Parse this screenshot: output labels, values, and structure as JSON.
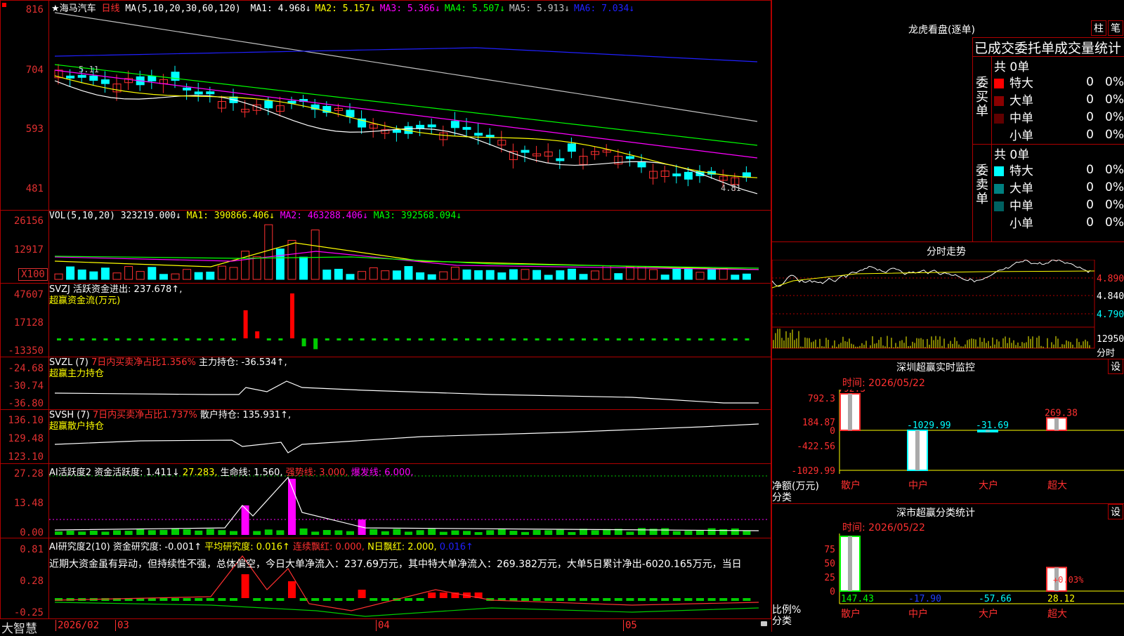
{
  "header": {
    "stock": "★海马汽车",
    "period": "日线",
    "ma_label": "MA(5,10,20,30,60,120)",
    "ma": [
      {
        "label": "MA1:",
        "value": "4.968↓",
        "color": "#ffffff"
      },
      {
        "label": "MA2:",
        "value": "5.157↓",
        "color": "#ffff00"
      },
      {
        "label": "MA3:",
        "value": "5.366↓",
        "color": "#ff00ff"
      },
      {
        "label": "MA4:",
        "value": "5.507↓",
        "color": "#00ff00"
      },
      {
        "label": "MA5:",
        "value": "5.913↓",
        "color": "#c0c0c0"
      },
      {
        "label": "MA6:",
        "value": "7.034↓",
        "color": "#2020ff"
      }
    ],
    "price_high_note": "5.11",
    "price_low_note": "4.81"
  },
  "axes": {
    "price": [
      "816",
      "704",
      "593",
      "481"
    ],
    "vol": [
      "26156",
      "12917",
      "X100"
    ],
    "svzj": [
      "47607",
      "17128",
      "-13350"
    ],
    "svzl": [
      "-24.68",
      "-30.74",
      "-36.80"
    ],
    "svsh": [
      "136.10",
      "129.48",
      "123.10"
    ],
    "ai": [
      "27.28",
      "13.48",
      "0.00"
    ],
    "air": [
      "0.81",
      "0.28",
      "-0.25"
    ]
  },
  "vol_header": {
    "name": "VOL(5,10,20)",
    "value": "323219.000↓",
    "ma1": "MA1: 390866.406↓",
    "ma2": "MA2: 463288.406↓",
    "ma3": "MA3: 392568.094↓"
  },
  "svzj_header": {
    "name": "SVZJ",
    "desc": "活跃资金进出: 237.678↑,",
    "sub": "超赢资金流(万元)"
  },
  "svzl_header": {
    "name": "SVZL (7)",
    "desc": "7日内买卖净占比1.356%",
    "hold": "主力持仓: -36.534↑,",
    "sub": "超赢主力持仓"
  },
  "svsh_header": {
    "name": "SVSH (7)",
    "desc": "7日内买卖净占比1.737%",
    "hold": "散户持仓: 135.931↑,",
    "sub": "超赢散户持仓"
  },
  "ai_header": {
    "name": "AI活跃度2",
    "a": "资金活跃度: 1.411↓",
    "b": "27.283,",
    "c": "生命线: 1.560,",
    "d": "强势线: 3.000,",
    "e": "爆发线: 6.000,"
  },
  "air_header": {
    "name": "AI研究度2(10)",
    "a": "资金研究度: -0.001↑",
    "b": "平均研究度: 0.016↑",
    "c": "连续飘红: 0.000,",
    "d": "N日飘红: 2.000,",
    "e": "0.016↑",
    "text": "近期大资金虽有异动，但持续性不强，总体偏空，今日大单净流入：237.69万元，其中特大单净流入：269.382万元，大单5日累计净出-6020.165万元，当日"
  },
  "footer": {
    "brand": "大智慧",
    "dates": [
      "2026/02",
      "03",
      "04",
      "05"
    ]
  },
  "right": {
    "dragon_title": "龙虎看盘(逐单)",
    "btn_bar": "柱",
    "btn_pen": "笔",
    "stats_header": "已成交委托单成交量统计",
    "buy_label": "委买单",
    "sell_label": "委卖单",
    "buy_total": "共 0单",
    "sell_total": "共 0单",
    "buy_rows": [
      {
        "name": "特大",
        "num": "0",
        "pct": "0%",
        "color": "#ff0000"
      },
      {
        "name": "大单",
        "num": "0",
        "pct": "0%",
        "color": "#8b0000"
      },
      {
        "name": "中单",
        "num": "0",
        "pct": "0%",
        "color": "#600000"
      },
      {
        "name": "小单",
        "num": "0",
        "pct": "0%",
        "color": ""
      }
    ],
    "sell_rows": [
      {
        "name": "特大",
        "num": "0",
        "pct": "0%",
        "color": "#00ffff"
      },
      {
        "name": "大单",
        "num": "0",
        "pct": "0%",
        "color": "#008080"
      },
      {
        "name": "中单",
        "num": "0",
        "pct": "0%",
        "color": "#006060"
      },
      {
        "name": "小单",
        "num": "0",
        "pct": "0%",
        "color": ""
      }
    ],
    "intraday_title": "分时走势",
    "intraday_ticks": [
      "4.890",
      "4.840",
      "4.790"
    ],
    "intraday_vol": "12950",
    "intraday_vol_label": "分时",
    "monitor_title": "深圳超赢实时监控",
    "monitor_btn": "设",
    "monitor_time": "时间: 2026/05/22",
    "monitor_axis": [
      "792.3",
      "184.87",
      "0",
      "-422.56",
      "-1029.99"
    ],
    "monitor_unit": "净额(万元)",
    "monitor_cat_label": "分类",
    "monitor_bars": [
      {
        "cat": "散户",
        "value": 792.3,
        "label": "792.3"
      },
      {
        "cat": "中户",
        "value": -1029.99,
        "label": "-1029.99"
      },
      {
        "cat": "大户",
        "value": -31.69,
        "label": "-31.69"
      },
      {
        "cat": "超大",
        "value": 269.38,
        "label": "269.38"
      }
    ],
    "class_title": "深市超赢分类统计",
    "class_btn": "设",
    "class_time": "时间: 2026/05/22",
    "class_axis": [
      "75",
      "50",
      "25",
      "0"
    ],
    "class_unit": "比例%",
    "class_cat_label": "分类",
    "class_note": "+0.03%",
    "class_bars": [
      {
        "cat": "散户",
        "value": 147.43,
        "label": "147.43"
      },
      {
        "cat": "中户",
        "value": -17.9,
        "label": "-17.90"
      },
      {
        "cat": "大户",
        "value": -57.66,
        "label": "-57.66"
      },
      {
        "cat": "超大",
        "value": 28.12,
        "label": "28.12"
      }
    ]
  }
}
